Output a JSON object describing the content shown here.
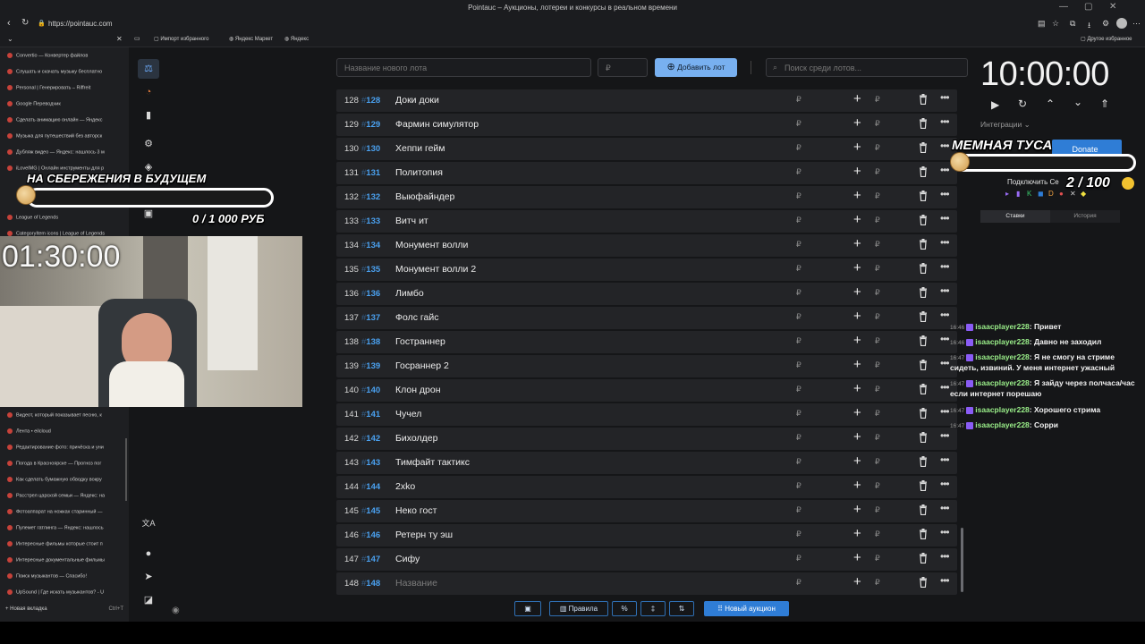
{
  "browser": {
    "title": "Pointauc – Аукционы, лотереи и конкурсы в реальном времени",
    "url": "https://pointauc.com",
    "bookmarks": [
      "Импорт избранного",
      "Яндекс Маркет",
      "Яндекс"
    ],
    "other_bookmarks": "Другое избранное"
  },
  "sidebar": {
    "items": [
      "Convertio — Конвертер файлов",
      "Слушать и скачать музыку бесплатно",
      "Personal | Генерировать – Riffreit",
      "Google Переводчик",
      "Сделать анимацию онлайн — Яндекс",
      "Музыка для путешествий без авторск",
      "Дубляж видео — Яндекс: нашлось 3 м",
      "iLoveIMG | Онлайн инструменты для р",
      "League of Legends",
      "CategoryItem icons | League of Legends",
      "Видеот, который показывает песню, к",
      "Лента • eilcloud",
      "Редактирование фото: причёска и уни",
      "Погода в Красноярске — Прогноз пог",
      "Как сделать бумажную обводку вокру",
      "Расстрел царской семьи — Яндекс: на",
      "Фотоаппарат на ножках старинный —",
      "Пулемет гатлинга — Яндекс: нашлось",
      "Интересные фильмы которые стоит п",
      "Интересные документальные фильмы",
      "Поиск музыкантов — Спасибо!",
      "UpSound | Где искать музыкантов? - U"
    ],
    "new_tab": "Новая вкладка",
    "new_tab_shortcut": "Ctrl+T"
  },
  "topbar": {
    "lot_placeholder": "Название нового лота",
    "amount_placeholder": "₽",
    "add_button": "Добавить лот",
    "search_placeholder": "Поиск среди лотов..."
  },
  "lots": [
    {
      "num": "128",
      "id": "128",
      "name": "Доки доки"
    },
    {
      "num": "129",
      "id": "129",
      "name": "Фармин симулятор"
    },
    {
      "num": "130",
      "id": "130",
      "name": "Хеппи гейм"
    },
    {
      "num": "131",
      "id": "131",
      "name": "Политопия"
    },
    {
      "num": "132",
      "id": "132",
      "name": "Выюфайндер"
    },
    {
      "num": "133",
      "id": "133",
      "name": "Витч ит"
    },
    {
      "num": "134",
      "id": "134",
      "name": "Монумент волли"
    },
    {
      "num": "135",
      "id": "135",
      "name": "Монумент волли 2"
    },
    {
      "num": "136",
      "id": "136",
      "name": "Лимбо"
    },
    {
      "num": "137",
      "id": "137",
      "name": "Фолс гайс"
    },
    {
      "num": "138",
      "id": "138",
      "name": "Гостраннер"
    },
    {
      "num": "139",
      "id": "139",
      "name": "Госраннер 2"
    },
    {
      "num": "140",
      "id": "140",
      "name": "Клон дрон"
    },
    {
      "num": "141",
      "id": "141",
      "name": "Чучел"
    },
    {
      "num": "142",
      "id": "142",
      "name": "Бихолдер"
    },
    {
      "num": "143",
      "id": "143",
      "name": "Тимфайт тактикс"
    },
    {
      "num": "144",
      "id": "144",
      "name": "2xko"
    },
    {
      "num": "145",
      "id": "145",
      "name": "Неко гост"
    },
    {
      "num": "146",
      "id": "146",
      "name": "Ретерн ту эш"
    },
    {
      "num": "147",
      "id": "147",
      "name": "Сифу"
    },
    {
      "num": "148",
      "id": "148",
      "name": "Название",
      "placeholder": true
    }
  ],
  "lot_currency": "₽",
  "bottombar": {
    "rules": "Правила",
    "new_auction": "Новый аукцион"
  },
  "right": {
    "timer": "10:00:00",
    "integrations": "Интеграции",
    "donate": "Donate",
    "connect": "Подключить Се",
    "tabs": [
      "Ставки",
      "История"
    ]
  },
  "overlay": {
    "goal1_title": "НА СБЕРЕЖЕНИЯ В БУДУЩЕМ",
    "goal1_progress": "0 / 1 000 РУБ",
    "goal2_title": "МЕМНАЯ ТУСА",
    "goal2_progress": "2 / 100",
    "cam_timer": "01:30:00"
  },
  "chat": [
    {
      "time": "16:46",
      "user": "isaacplayer228",
      "text": "Привет"
    },
    {
      "time": "16:46",
      "user": "isaacplayer228",
      "text": "Давно не заходил"
    },
    {
      "time": "16:47",
      "user": "isaacplayer228",
      "text": "Я не смогу на стриме сидеть, извиний. У меня интернет ужасный"
    },
    {
      "time": "16:47",
      "user": "isaacplayer228",
      "text": "Я зайду через полчаса/час если интернет порешаю"
    },
    {
      "time": "16:47",
      "user": "isaacplayer228",
      "text": "Хорошего стрима"
    },
    {
      "time": "16:47",
      "user": "isaacplayer228",
      "text": "Сорри"
    }
  ],
  "colors": {
    "accent": "#2f7dd6",
    "id_blue": "#4aa1f0",
    "chat_user": "#9bf08a"
  }
}
